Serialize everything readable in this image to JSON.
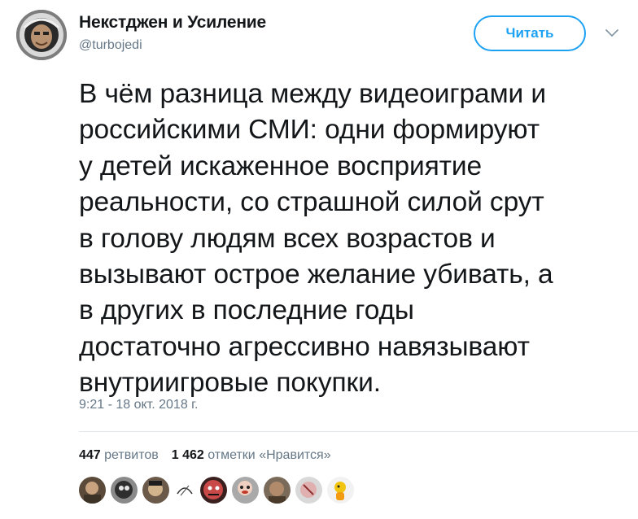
{
  "author": {
    "name": "Некстджен и Усиление",
    "handle": "@turbojedi"
  },
  "follow_button": {
    "label": "Читать"
  },
  "icons": {
    "avatar": "astronaut-avatar",
    "menu": "chevron-down-icon"
  },
  "tweet": {
    "lines": [
      "В чём разница между видеоиграми и",
      "российскими СМИ: одни формируют",
      "у детей искаженное восприятие",
      "реальности, со страшной силой срут",
      "в голову людям всех возрастов и",
      "вызывают острое желание убивать, а",
      "в других в последние годы",
      "достаточно агрессивно навязывают",
      "внутриигровые покупки."
    ],
    "timestamp": "9:21 - 18 окт. 2018 г."
  },
  "stats": {
    "retweets_count": "447",
    "retweets_label": "ретвитов",
    "likes_count": "1 462",
    "likes_label": "отметки «Нравится»"
  },
  "colors": {
    "accent": "#1da1f2",
    "text": "#14171a",
    "secondary": "#657786",
    "divider": "#e1e8ed"
  }
}
